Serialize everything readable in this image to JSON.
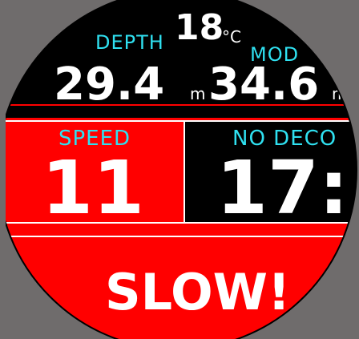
{
  "header": {
    "temperature_value": "18",
    "temperature_unit": "°C",
    "depth_label": "DEPTH",
    "depth_value": "29.4",
    "depth_unit": "m",
    "mod_label": "MOD",
    "mod_value": "34.6",
    "mod_unit": "m"
  },
  "middle": {
    "speed_label": "SPEED",
    "speed_value": "11",
    "nodeco_label": "NO DECO",
    "nodeco_value": "17:"
  },
  "alert": {
    "message": "SLOW!"
  },
  "colors": {
    "background": "#000000",
    "alert_red": "#ff0000",
    "label_cyan": "#2fe0f0",
    "value_white": "#ffffff",
    "frame_gray": "#6f6c6c"
  }
}
